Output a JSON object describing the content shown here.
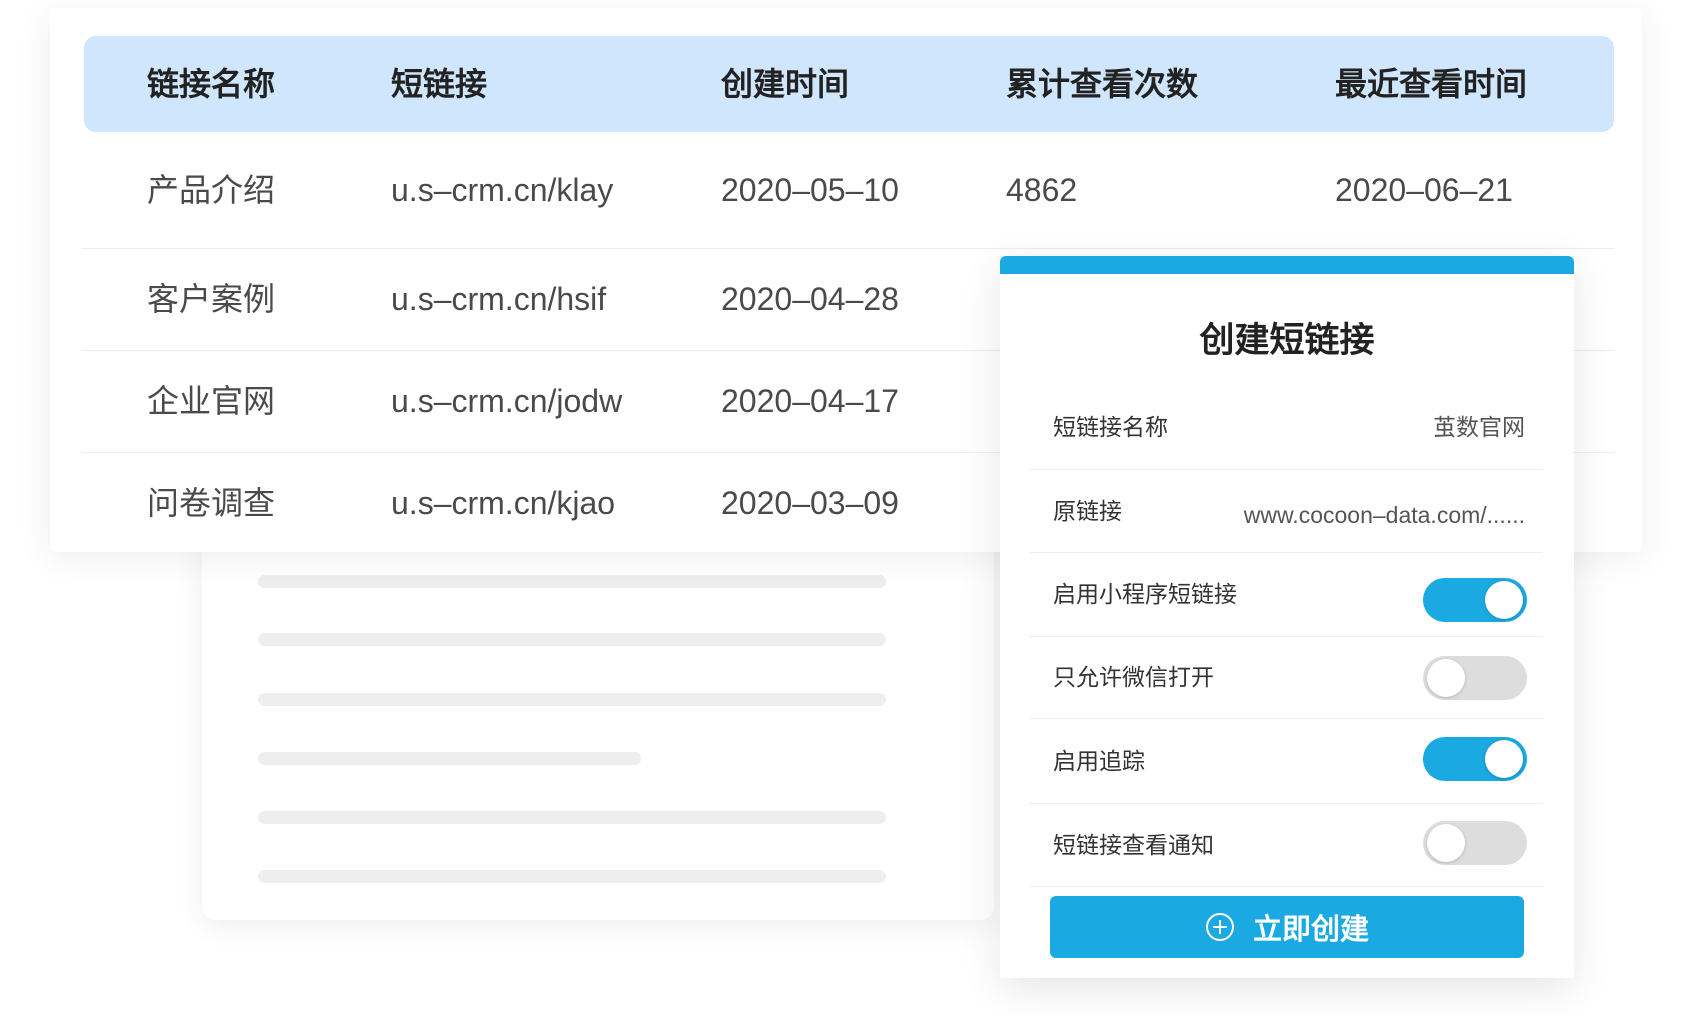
{
  "table": {
    "columns": [
      "链接名称",
      "短链接",
      "创建时间",
      "累计查看次数",
      "最近查看时间"
    ],
    "rows": [
      {
        "name": "产品介绍",
        "short_link": "u.s–crm.cn/klay",
        "created": "2020–05–10",
        "views": "4862",
        "last_viewed": "2020–06–21"
      },
      {
        "name": "客户案例",
        "short_link": "u.s–crm.cn/hsif",
        "created": "2020–04–28"
      },
      {
        "name": "企业官网",
        "short_link": "u.s–crm.cn/jodw",
        "created": "2020–04–17"
      },
      {
        "name": "问卷调查",
        "short_link": "u.s–crm.cn/kjao",
        "created": "2020–03–09"
      }
    ]
  },
  "create_panel": {
    "title": "创建短链接",
    "fields": [
      {
        "label": "短链接名称",
        "value": "茧数官网"
      },
      {
        "label": "原链接",
        "value": "www.cocoon–data.com/......"
      }
    ],
    "toggles": [
      {
        "label": "启用小程序短链接",
        "state": "on"
      },
      {
        "label": "只允许微信打开",
        "state": "off"
      },
      {
        "label": "启用追踪",
        "state": "on"
      },
      {
        "label": "短链接查看通知",
        "state": "off"
      }
    ],
    "button_label": "立即创建",
    "button_icon": "circle-plus-icon"
  },
  "colors": {
    "accent": "#1ba9e1",
    "header_bg": "#cfe6fd",
    "toggle_off": "#dddddd"
  }
}
